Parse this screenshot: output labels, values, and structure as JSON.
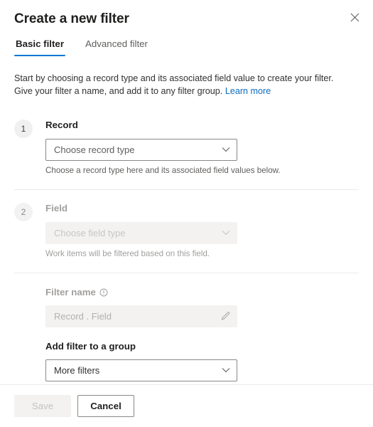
{
  "dialog": {
    "title": "Create a new filter",
    "close_icon": "close-icon"
  },
  "tabs": [
    {
      "label": "Basic filter",
      "active": true
    },
    {
      "label": "Advanced filter",
      "active": false
    }
  ],
  "intro": {
    "text": "Start by choosing a record type and its associated field value to create your filter. Give your filter a name, and add it to any filter group.",
    "link_text": "Learn more"
  },
  "steps": [
    {
      "number": "1",
      "label": "Record",
      "dropdown_value": "Choose record type",
      "hint": "Choose a record type here and its associated field values below.",
      "disabled": false
    },
    {
      "number": "2",
      "label": "Field",
      "dropdown_value": "Choose field type",
      "hint": "Work items will be filtered based on this field.",
      "disabled": true
    }
  ],
  "filter_name": {
    "label": "Filter name",
    "info_icon": "info-circle-icon",
    "value": "Record . Field",
    "edit_icon": "pencil-icon"
  },
  "filter_group": {
    "label": "Add filter to a group",
    "dropdown_value": "More filters"
  },
  "footer": {
    "save_label": "Save",
    "cancel_label": "Cancel"
  },
  "colors": {
    "accent": "#0078d4",
    "link": "#0f6cbd",
    "text": "#323130",
    "disabled_text": "#a19f9d",
    "field_disabled_bg": "#f3f2f1",
    "divider": "#edebe9"
  }
}
